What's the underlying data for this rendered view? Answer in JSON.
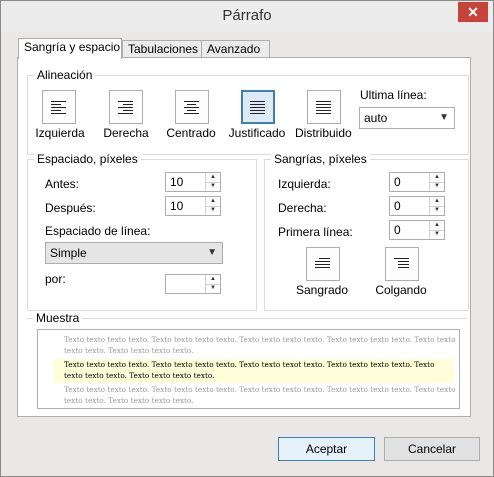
{
  "window": {
    "title": "Párrafo",
    "close_glyph": "✕"
  },
  "tabs": [
    {
      "label": "Sangría y espacio"
    },
    {
      "label": "Tabulaciones"
    },
    {
      "label": "Avanzado"
    }
  ],
  "alignment": {
    "group_title": "Alineación",
    "buttons": [
      {
        "label": "Izquierda",
        "icon": "align-left-icon"
      },
      {
        "label": "Derecha",
        "icon": "align-right-icon"
      },
      {
        "label": "Centrado",
        "icon": "align-center-icon"
      },
      {
        "label": "Justificado",
        "icon": "align-justify-icon",
        "selected": true
      },
      {
        "label": "Distribuido",
        "icon": "align-distributed-icon"
      }
    ],
    "last_line_label": "Ultima línea:",
    "last_line_value": "auto"
  },
  "spacing": {
    "group_title": "Espaciado, píxeles",
    "before_label": "Antes:",
    "before_value": "10",
    "after_label": "Después:",
    "after_value": "10",
    "line_spacing_label": "Espaciado de línea:",
    "line_spacing_value": "Simple",
    "by_label": "por:",
    "by_value": ""
  },
  "indents": {
    "group_title": "Sangrías, píxeles",
    "left_label": "Izquierda:",
    "left_value": "0",
    "right_label": "Derecha:",
    "right_value": "0",
    "first_line_label": "Primera línea:",
    "first_line_value": "0",
    "hanging_buttons": [
      {
        "label": "Sangrado",
        "icon": "first-line-indent-icon"
      },
      {
        "label": "Colgando",
        "icon": "hanging-indent-icon"
      }
    ]
  },
  "sample": {
    "group_title": "Muestra",
    "before_text": "Texto texto texto texto. Texto texto texto texto. Texto texto texto texto. Texto texto texto texto. Texto texto texto texto. Texto texto texto texto.",
    "current_text": "Texto texto texto texto. Texto texto texto texto. Texto texto texot texto. Texto texto texto texto. Texto texto texto texto. Texto texto texto texto.",
    "after_text": "Texto texto texto texto. Texto texto texto texto. Texto texto texto texto. Texto texto texto texto. Texto texto texto texto. Texto texto texto texto."
  },
  "footer": {
    "ok_label": "Aceptar",
    "cancel_label": "Cancelar"
  }
}
